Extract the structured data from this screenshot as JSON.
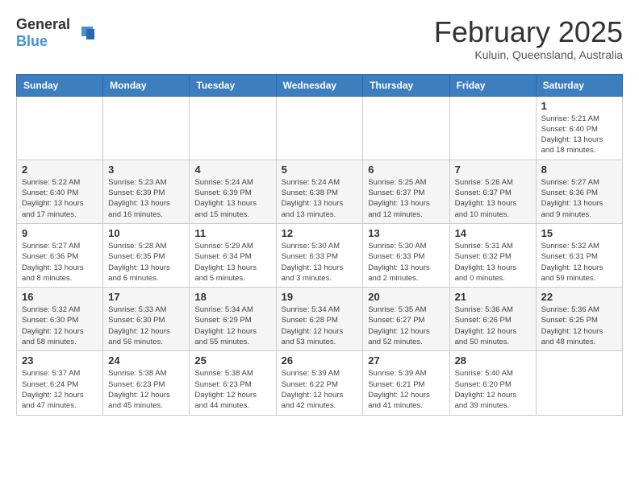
{
  "logo": {
    "general": "General",
    "blue": "Blue"
  },
  "header": {
    "month": "February 2025",
    "location": "Kuluin, Queensland, Australia"
  },
  "weekdays": [
    "Sunday",
    "Monday",
    "Tuesday",
    "Wednesday",
    "Thursday",
    "Friday",
    "Saturday"
  ],
  "weeks": [
    [
      null,
      null,
      null,
      null,
      null,
      null,
      {
        "day": "1",
        "sunrise": "Sunrise: 5:21 AM",
        "sunset": "Sunset: 6:40 PM",
        "daylight": "Daylight: 13 hours and 18 minutes."
      }
    ],
    [
      {
        "day": "2",
        "sunrise": "Sunrise: 5:22 AM",
        "sunset": "Sunset: 6:40 PM",
        "daylight": "Daylight: 13 hours and 17 minutes."
      },
      {
        "day": "3",
        "sunrise": "Sunrise: 5:23 AM",
        "sunset": "Sunset: 6:39 PM",
        "daylight": "Daylight: 13 hours and 16 minutes."
      },
      {
        "day": "4",
        "sunrise": "Sunrise: 5:24 AM",
        "sunset": "Sunset: 6:39 PM",
        "daylight": "Daylight: 13 hours and 15 minutes."
      },
      {
        "day": "5",
        "sunrise": "Sunrise: 5:24 AM",
        "sunset": "Sunset: 6:38 PM",
        "daylight": "Daylight: 13 hours and 13 minutes."
      },
      {
        "day": "6",
        "sunrise": "Sunrise: 5:25 AM",
        "sunset": "Sunset: 6:37 PM",
        "daylight": "Daylight: 13 hours and 12 minutes."
      },
      {
        "day": "7",
        "sunrise": "Sunrise: 5:26 AM",
        "sunset": "Sunset: 6:37 PM",
        "daylight": "Daylight: 13 hours and 10 minutes."
      },
      {
        "day": "8",
        "sunrise": "Sunrise: 5:27 AM",
        "sunset": "Sunset: 6:36 PM",
        "daylight": "Daylight: 13 hours and 9 minutes."
      }
    ],
    [
      {
        "day": "9",
        "sunrise": "Sunrise: 5:27 AM",
        "sunset": "Sunset: 6:36 PM",
        "daylight": "Daylight: 13 hours and 8 minutes."
      },
      {
        "day": "10",
        "sunrise": "Sunrise: 5:28 AM",
        "sunset": "Sunset: 6:35 PM",
        "daylight": "Daylight: 13 hours and 6 minutes."
      },
      {
        "day": "11",
        "sunrise": "Sunrise: 5:29 AM",
        "sunset": "Sunset: 6:34 PM",
        "daylight": "Daylight: 13 hours and 5 minutes."
      },
      {
        "day": "12",
        "sunrise": "Sunrise: 5:30 AM",
        "sunset": "Sunset: 6:33 PM",
        "daylight": "Daylight: 13 hours and 3 minutes."
      },
      {
        "day": "13",
        "sunrise": "Sunrise: 5:30 AM",
        "sunset": "Sunset: 6:33 PM",
        "daylight": "Daylight: 13 hours and 2 minutes."
      },
      {
        "day": "14",
        "sunrise": "Sunrise: 5:31 AM",
        "sunset": "Sunset: 6:32 PM",
        "daylight": "Daylight: 13 hours and 0 minutes."
      },
      {
        "day": "15",
        "sunrise": "Sunrise: 5:32 AM",
        "sunset": "Sunset: 6:31 PM",
        "daylight": "Daylight: 12 hours and 59 minutes."
      }
    ],
    [
      {
        "day": "16",
        "sunrise": "Sunrise: 5:32 AM",
        "sunset": "Sunset: 6:30 PM",
        "daylight": "Daylight: 12 hours and 58 minutes."
      },
      {
        "day": "17",
        "sunrise": "Sunrise: 5:33 AM",
        "sunset": "Sunset: 6:30 PM",
        "daylight": "Daylight: 12 hours and 56 minutes."
      },
      {
        "day": "18",
        "sunrise": "Sunrise: 5:34 AM",
        "sunset": "Sunset: 6:29 PM",
        "daylight": "Daylight: 12 hours and 55 minutes."
      },
      {
        "day": "19",
        "sunrise": "Sunrise: 5:34 AM",
        "sunset": "Sunset: 6:28 PM",
        "daylight": "Daylight: 12 hours and 53 minutes."
      },
      {
        "day": "20",
        "sunrise": "Sunrise: 5:35 AM",
        "sunset": "Sunset: 6:27 PM",
        "daylight": "Daylight: 12 hours and 52 minutes."
      },
      {
        "day": "21",
        "sunrise": "Sunrise: 5:36 AM",
        "sunset": "Sunset: 6:26 PM",
        "daylight": "Daylight: 12 hours and 50 minutes."
      },
      {
        "day": "22",
        "sunrise": "Sunrise: 5:36 AM",
        "sunset": "Sunset: 6:25 PM",
        "daylight": "Daylight: 12 hours and 48 minutes."
      }
    ],
    [
      {
        "day": "23",
        "sunrise": "Sunrise: 5:37 AM",
        "sunset": "Sunset: 6:24 PM",
        "daylight": "Daylight: 12 hours and 47 minutes."
      },
      {
        "day": "24",
        "sunrise": "Sunrise: 5:38 AM",
        "sunset": "Sunset: 6:23 PM",
        "daylight": "Daylight: 12 hours and 45 minutes."
      },
      {
        "day": "25",
        "sunrise": "Sunrise: 5:38 AM",
        "sunset": "Sunset: 6:23 PM",
        "daylight": "Daylight: 12 hours and 44 minutes."
      },
      {
        "day": "26",
        "sunrise": "Sunrise: 5:39 AM",
        "sunset": "Sunset: 6:22 PM",
        "daylight": "Daylight: 12 hours and 42 minutes."
      },
      {
        "day": "27",
        "sunrise": "Sunrise: 5:39 AM",
        "sunset": "Sunset: 6:21 PM",
        "daylight": "Daylight: 12 hours and 41 minutes."
      },
      {
        "day": "28",
        "sunrise": "Sunrise: 5:40 AM",
        "sunset": "Sunset: 6:20 PM",
        "daylight": "Daylight: 12 hours and 39 minutes."
      },
      null
    ]
  ]
}
